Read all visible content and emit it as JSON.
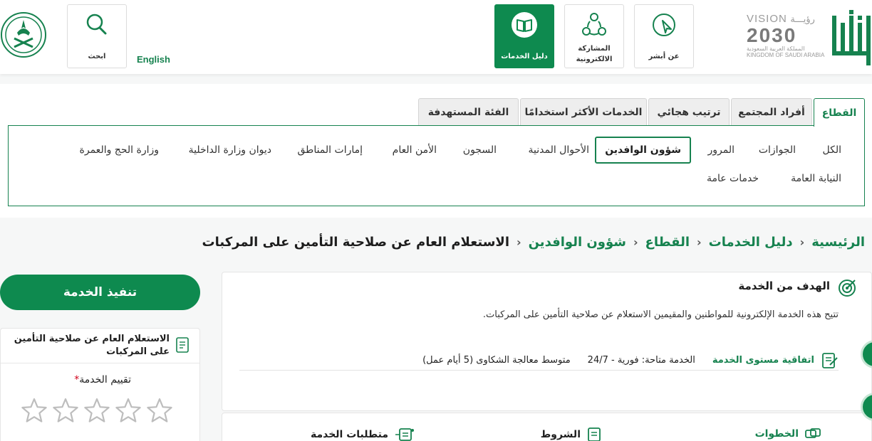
{
  "header": {
    "nav": [
      {
        "label": "عن أبشر",
        "icon": "cursor-pointer-icon"
      },
      {
        "label_line1": "المشاركة",
        "label_line2": "الالكترونية",
        "icon": "share-nodes-icon"
      },
      {
        "label": "دليل الخدمات",
        "icon": "book-icon",
        "active": true
      }
    ],
    "search_label": "ابحث",
    "language_toggle": "English",
    "vision": {
      "title": "VISION",
      "arabic": "رؤيـــة",
      "year": "2030",
      "ar_line": "المملكة العربية السعودية",
      "en_line": "KINGDOM OF SAUDI ARABIA"
    }
  },
  "tabs": {
    "items": [
      "القطاع",
      "أفراد المجتمع",
      "ترتيب هجائي",
      "الخدمات الأكثر استخدامًا",
      "الفئة المستهدفة"
    ],
    "active_index": 0
  },
  "categories": {
    "row1": [
      "الكل",
      "الجوازات",
      "المرور",
      "شؤون الوافدين",
      "الأحوال المدنية",
      "السجون",
      "الأمن العام",
      "إمارات المناطق",
      "ديوان وزارة الداخلية",
      "وزارة الحج والعمرة"
    ],
    "row2": [
      "النيابة العامة",
      "خدمات عامة"
    ],
    "selected": "شؤون الوافدين"
  },
  "breadcrumb": {
    "items": [
      "الرئيسية",
      "دليل الخدمات",
      "القطاع",
      "شؤون الوافدين"
    ],
    "current": "الاستعلام العام عن صلاحية التأمين على المركبات"
  },
  "service": {
    "goal_title": "الهدف من الخدمة",
    "goal_desc": "تتيح هذه الخدمة الإلكترونية للمواطنين والمقيمين الاستعلام عن صلاحية التأمين على المركبات.",
    "sla_label": "اتفاقية مستوى الخدمة",
    "sla_availability": "الخدمة متاحة: فورية - 24/7",
    "sla_complaints": "متوسط معالجة الشكاوى (5 أيام عمل)",
    "sections": [
      "الخطوات",
      "الشروط",
      "متطلبات الخدمة"
    ]
  },
  "side": {
    "execute_label": "تنفيذ الخدمة",
    "service_name": "الاستعلام العام عن صلاحية التأمين على المركبات",
    "rating_label": "تقييم الخدمة",
    "required_mark": "*",
    "stars_total": 5,
    "stars_filled": 0
  },
  "colors": {
    "accent": "#0e8a4f",
    "accent_text": "#16824f",
    "border": "#dcdcdc"
  }
}
